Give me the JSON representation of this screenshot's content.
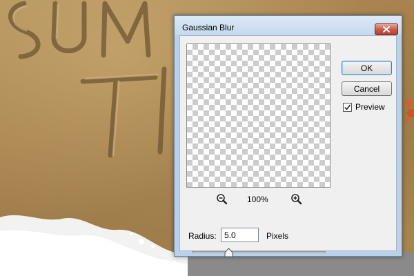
{
  "dialog": {
    "title": "Gaussian Blur",
    "zoom_level": "100%",
    "buttons": {
      "ok": "OK",
      "cancel": "Cancel"
    },
    "preview": {
      "label": "Preview",
      "checked": true
    },
    "radius": {
      "label": "Radius:",
      "value": "5.0",
      "unit": "Pixels",
      "slider_fraction": 0.25
    }
  },
  "icons": {
    "close": "close-icon",
    "zoom_out": "zoom-out-icon",
    "zoom_in": "zoom-in-icon",
    "check": "checkmark-icon",
    "slider": "slider-thumb-icon"
  },
  "colors": {
    "sand": "#a8834f",
    "close_button": "#c85a47",
    "dialog_frame": "#b9d1ea",
    "dialog_face": "#f0f0f0"
  }
}
